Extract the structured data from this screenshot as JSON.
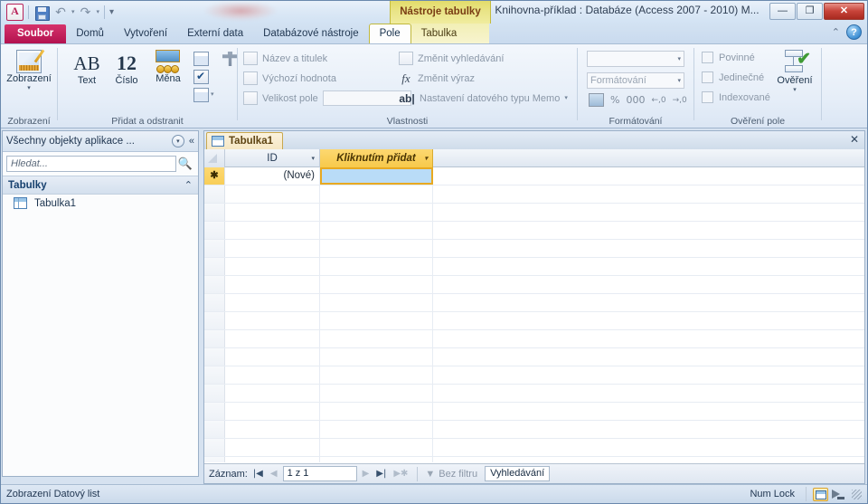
{
  "window": {
    "title": "Knihovna-příklad : Databáze (Access 2007 - 2010) M...",
    "minimize": "—",
    "maximize": "❐",
    "close": "✕",
    "app_logo": "A"
  },
  "quick_access": {
    "save": "save-icon",
    "undo": "↶",
    "undo_caret": "▾",
    "redo": "↷",
    "redo_caret": "▾",
    "customize": "▾"
  },
  "context_tab_label": "Nástroje tabulky",
  "tabs": [
    {
      "label": "Soubor",
      "kind": "file"
    },
    {
      "label": "Domů",
      "kind": "normal"
    },
    {
      "label": "Vytvoření",
      "kind": "normal"
    },
    {
      "label": "Externí data",
      "kind": "normal"
    },
    {
      "label": "Databázové nástroje",
      "kind": "normal"
    },
    {
      "label": "Pole",
      "kind": "active"
    },
    {
      "label": "Tabulka",
      "kind": "context"
    }
  ],
  "ribbon_right": {
    "collapse": "⌃",
    "help": "?"
  },
  "ribbon": {
    "groups": [
      {
        "title": "Zobrazení",
        "view_button": {
          "label": "Zobrazení",
          "caret": "▾",
          "icon": "view-icon"
        }
      },
      {
        "title": "Přidat a odstranit",
        "buttons": [
          {
            "label": "Text",
            "icon": "ab-text-icon",
            "glyph": "AB"
          },
          {
            "label": "Číslo",
            "icon": "number-icon",
            "glyph": "12"
          },
          {
            "label": "Měna",
            "icon": "currency-icon"
          }
        ],
        "small_icons": [
          {
            "name": "date-time-icon"
          },
          {
            "name": "more-fields-icon"
          },
          {
            "name": "yes-no-icon",
            "glyph": "✔"
          },
          {
            "name": "delete-field-icon",
            "caret": "▾"
          }
        ]
      },
      {
        "title": "Vlastnosti",
        "items": [
          {
            "label": "Název a titulek",
            "icon": "name-caption-icon"
          },
          {
            "label": "Výchozí hodnota",
            "icon": "default-value-icon"
          },
          {
            "label": "Velikost pole",
            "icon": "field-size-icon",
            "input_value": ""
          },
          {
            "label": "Změnit vyhledávání",
            "icon": "modify-lookup-icon"
          },
          {
            "label": "Změnit výraz",
            "icon": "fx-icon",
            "glyph": "fx"
          },
          {
            "label": "Nastavení datového typu Memo",
            "icon": "memo-settings-icon",
            "glyph": "ab|",
            "caret": "▾"
          }
        ]
      },
      {
        "title": "Formátování",
        "datatype_value": "",
        "datatype_caret": "▾",
        "format_value": "Formátování",
        "format_caret": "▾",
        "buttons": [
          {
            "name": "currency-format-icon",
            "glyph": ""
          },
          {
            "name": "percent-icon",
            "glyph": "%"
          },
          {
            "name": "comma-icon",
            "glyph": "000"
          },
          {
            "name": "increase-decimals-icon",
            "glyph": ""
          },
          {
            "name": "decrease-decimals-icon",
            "glyph": ""
          }
        ]
      },
      {
        "title": "Ověření pole",
        "checkboxes": [
          {
            "label": "Povinné",
            "checked": false
          },
          {
            "label": "Jedinečné",
            "checked": false
          },
          {
            "label": "Indexované",
            "checked": false
          }
        ],
        "validation_button": {
          "label": "Ověření",
          "caret": "▾",
          "icon": "validation-icon"
        }
      }
    ]
  },
  "nav_pane": {
    "header_title": "Všechny objekty aplikace ...",
    "dropdown_icon": "▾",
    "collapse_icon": "«",
    "search_placeholder": "Hledat...",
    "search_value": "",
    "search_icon": "search-icon",
    "group": {
      "label": "Tabulky",
      "collapse": "⌃"
    },
    "items": [
      {
        "label": "Tabulka1",
        "icon": "table-icon"
      }
    ]
  },
  "datasheet": {
    "tab_label": "Tabulka1",
    "tab_icon": "table-icon",
    "close_icon": "✕",
    "columns": [
      {
        "label": "ID",
        "caret": "▾",
        "kind": "id"
      },
      {
        "label": "Kliknutím přidat",
        "caret": "▾",
        "kind": "add-new"
      }
    ],
    "rows": [
      {
        "selector": "✱",
        "id": "(Nové)",
        "add_new": ""
      }
    ],
    "empty_row_count": 16,
    "nav": {
      "label": "Záznam:",
      "first": "|◀",
      "prev": "◀",
      "position": "1 z 1",
      "next": "▶",
      "last": "▶|",
      "new": "▶✱",
      "filter_label": "Bez filtru",
      "filter_icon": "filter-icon",
      "search_value": "Vyhledávání"
    }
  },
  "status_bar": {
    "view_text": "Zobrazení Datový list",
    "num_lock": "Num Lock",
    "views": [
      {
        "name": "datasheet-view-button",
        "active": true
      },
      {
        "name": "design-view-button",
        "active": false
      }
    ]
  },
  "colors": {
    "file_tab": "#b3124f",
    "context_tab": "#e9e487",
    "add_new_column": "#f7c94b",
    "selected_cell": "#b9dcf7",
    "accent_border": "#e8a920"
  }
}
